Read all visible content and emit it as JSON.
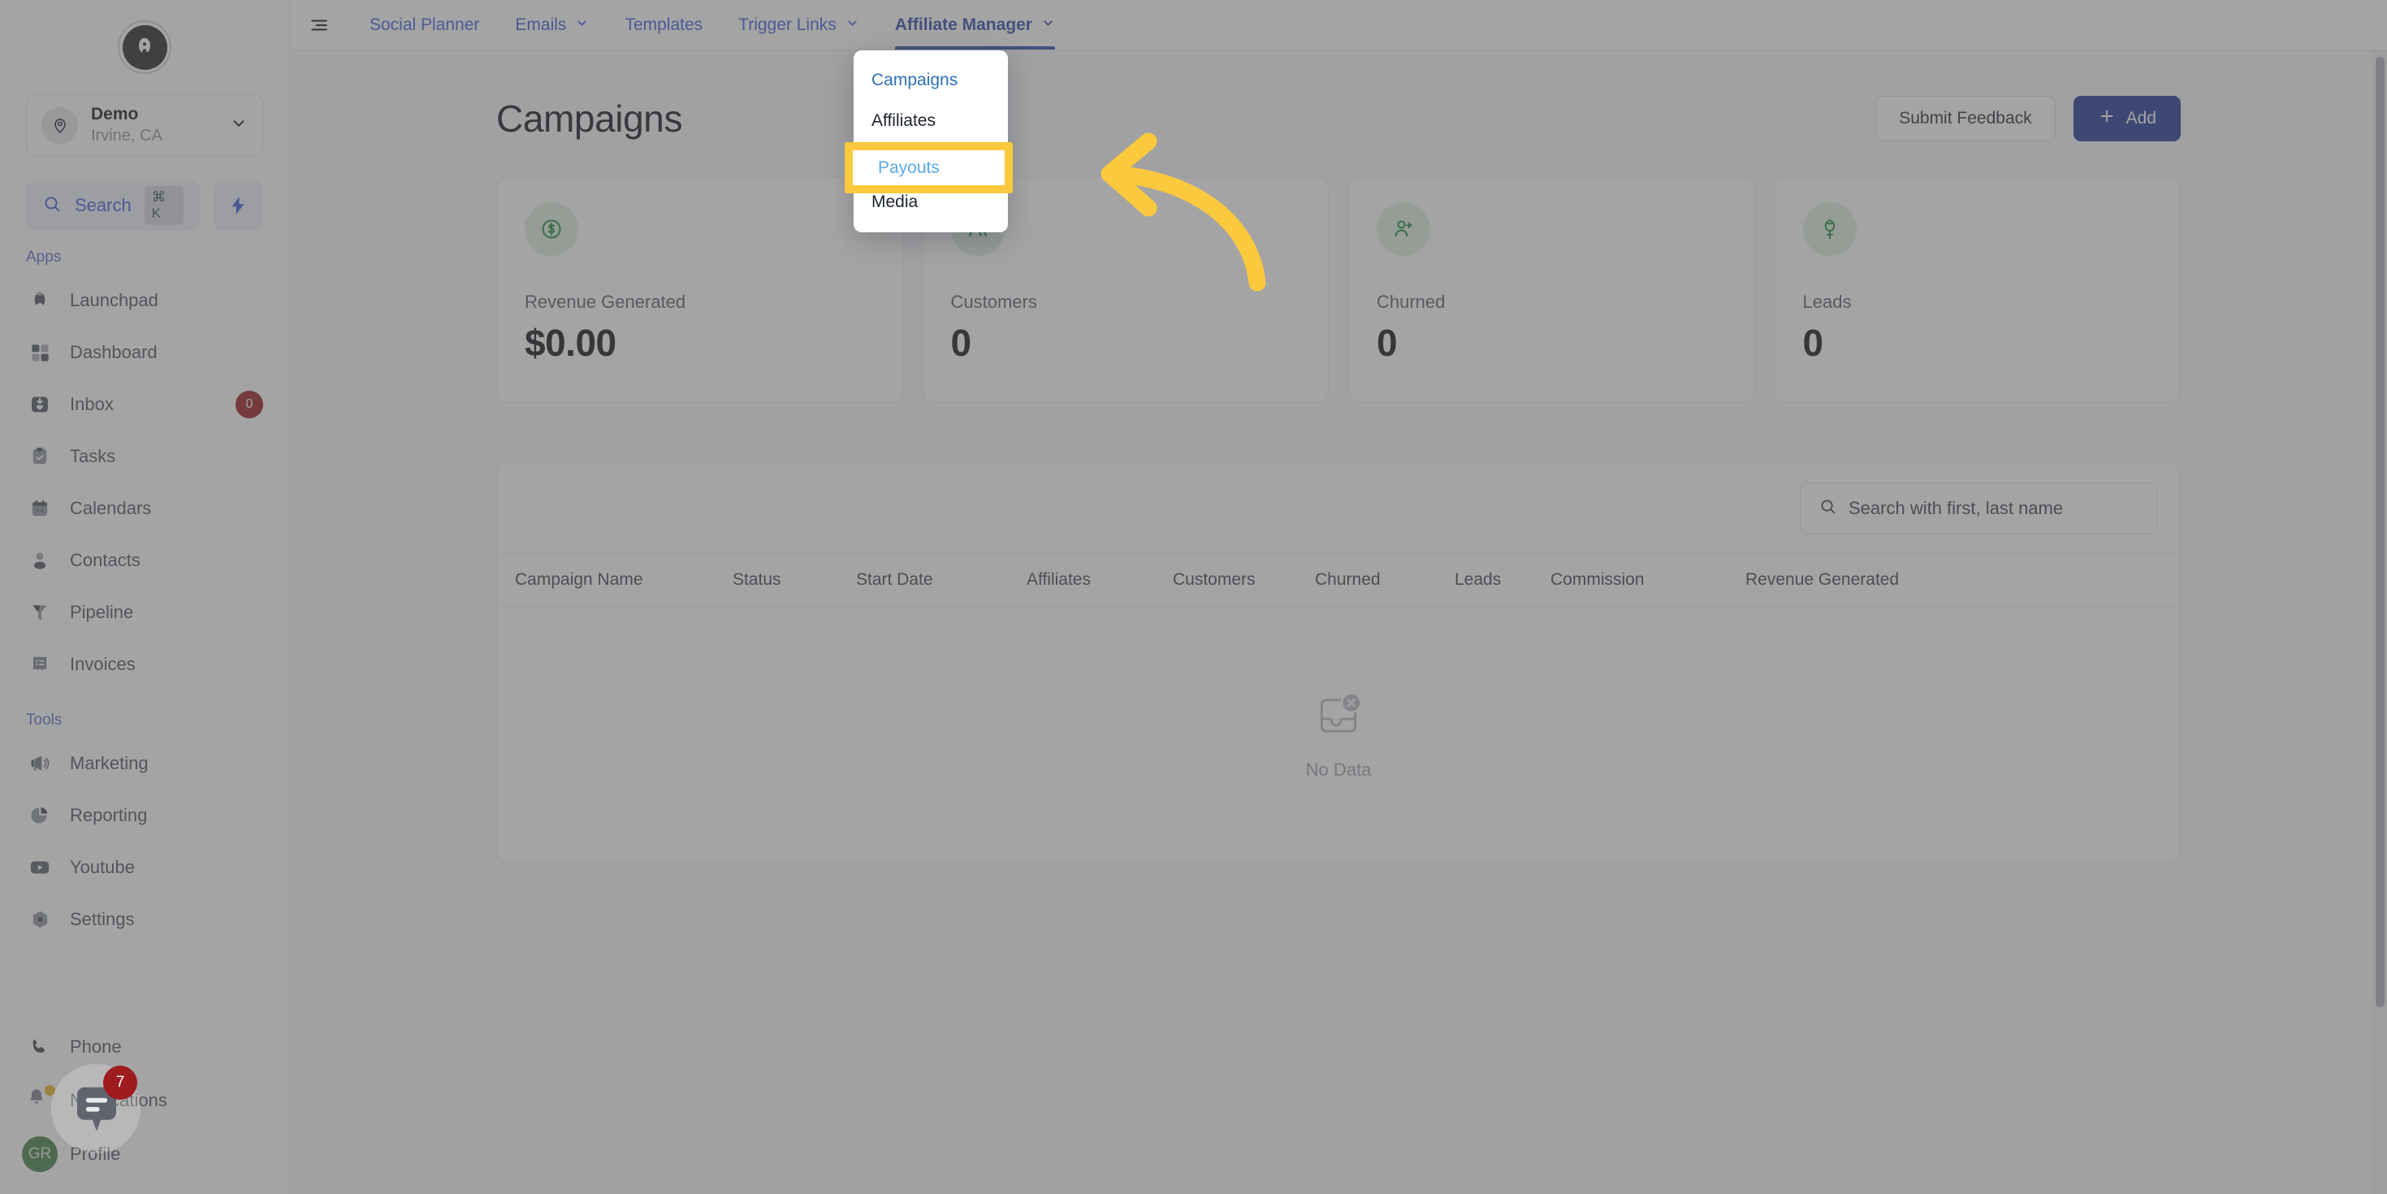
{
  "sidebar": {
    "logo_glyph": "A",
    "location": {
      "name": "Demo",
      "sub": "Irvine, CA",
      "avatar_icon": "map-pin-icon",
      "chevron_icon": "chevron-down-icon"
    },
    "search": {
      "label": "Search",
      "shortcut": "⌘ K",
      "icon": "search-icon",
      "accent": "#3b5bdb"
    },
    "quick_action_icon": "lightning-bolt-icon",
    "sections": [
      {
        "label": "Apps",
        "items": [
          {
            "label": "Launchpad",
            "icon": "rocket-icon"
          },
          {
            "label": "Dashboard",
            "icon": "grid-icon"
          },
          {
            "label": "Inbox",
            "icon": "inbox-icon",
            "badge": "0"
          },
          {
            "label": "Tasks",
            "icon": "clipboard-check-icon"
          },
          {
            "label": "Calendars",
            "icon": "calendar-icon"
          },
          {
            "label": "Contacts",
            "icon": "user-icon"
          },
          {
            "label": "Pipeline",
            "icon": "funnel-icon"
          },
          {
            "label": "Invoices",
            "icon": "invoice-icon"
          }
        ]
      },
      {
        "label": "Tools",
        "items": [
          {
            "label": "Marketing",
            "icon": "megaphone-icon"
          },
          {
            "label": "Reporting",
            "icon": "pie-chart-icon"
          },
          {
            "label": "Youtube",
            "icon": "youtube-icon"
          },
          {
            "label": "Settings",
            "icon": "gear-icon"
          }
        ]
      }
    ],
    "footer": [
      {
        "label": "Phone",
        "icon": "phone-icon"
      },
      {
        "label": "Notifications",
        "icon": "bell-icon"
      },
      {
        "label": "Profile",
        "icon": "avatar",
        "avatar_initials": "GR"
      }
    ]
  },
  "topnav": {
    "menu_toggle_icon": "hamburger-icon",
    "items": [
      {
        "label": "Social Planner",
        "caret": false,
        "active": false
      },
      {
        "label": "Emails",
        "caret": true,
        "active": false
      },
      {
        "label": "Templates",
        "caret": false,
        "active": false
      },
      {
        "label": "Trigger Links",
        "caret": true,
        "active": false
      },
      {
        "label": "Affiliate Manager",
        "caret": true,
        "active": true
      }
    ],
    "link_color": "#3b5bdb",
    "active_color": "#2c46a8"
  },
  "dropdown": {
    "open_for": "Affiliate Manager",
    "items": [
      {
        "label": "Campaigns",
        "active": true
      },
      {
        "label": "Affiliates",
        "active": false
      },
      {
        "label": "Payouts",
        "active": false
      },
      {
        "label": "Media",
        "active": false
      }
    ]
  },
  "annotation": {
    "highlight_label": "Payouts",
    "highlight_border_color": "#fbc93d",
    "highlight_text_color": "#5aa9e6",
    "arrow": {
      "icon": "curved-arrow-left-icon",
      "color": "#fbc93d"
    }
  },
  "page": {
    "title": "Campaigns",
    "submit_feedback_label": "Submit Feedback",
    "add_label": "Add",
    "add_icon": "plus-icon",
    "add_button_color": "#1c3694"
  },
  "stats": [
    {
      "label": "Revenue Generated",
      "value": "$0.00",
      "icon": "dollar-circle-icon"
    },
    {
      "label": "Customers",
      "value": "0",
      "icon": "users-icon"
    },
    {
      "label": "Churned",
      "value": "0",
      "icon": "user-plus-icon"
    },
    {
      "label": "Leads",
      "value": "0",
      "icon": "leads-icon"
    }
  ],
  "table": {
    "search_placeholder": "Search with first, last name",
    "search_icon": "search-icon",
    "columns": [
      "Campaign Name",
      "Status",
      "Start Date",
      "Affiliates",
      "Customers",
      "Churned",
      "Leads",
      "Commission",
      "Revenue Generated"
    ],
    "empty": {
      "text": "No Data",
      "icon": "no-data-inbox-icon"
    },
    "rows": []
  },
  "chat_widget": {
    "icon": "chat-bubble-icon",
    "unread": "7",
    "badge_color": "#9e1b1e"
  }
}
